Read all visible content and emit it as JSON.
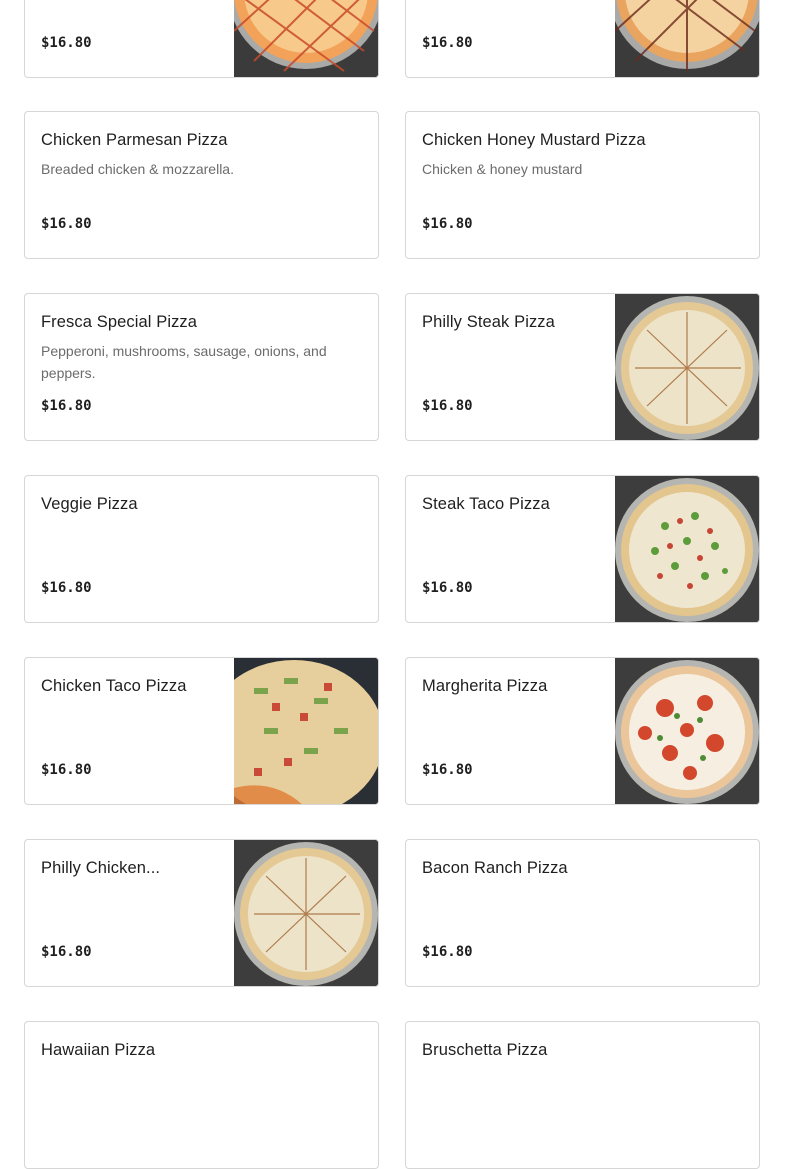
{
  "menu": {
    "items": [
      {
        "name": "",
        "description": "",
        "price": "$16.80",
        "image": "pizza-buffalo"
      },
      {
        "name": "",
        "description": "",
        "price": "$16.80",
        "image": "pizza-bbq"
      },
      {
        "name": "Chicken Parmesan Pizza",
        "description": "Breaded chicken & mozzarella.",
        "price": "$16.80",
        "image": null
      },
      {
        "name": "Chicken Honey Mustard Pizza",
        "description": "Chicken & honey mustard",
        "price": "$16.80",
        "image": null
      },
      {
        "name": "Fresca Special Pizza",
        "description": "Pepperoni, mushrooms, sausage, onions, and peppers.",
        "price": "$16.80",
        "image": null
      },
      {
        "name": "Philly Steak Pizza",
        "description": "",
        "price": "$16.80",
        "image": "pizza-white"
      },
      {
        "name": "Veggie Pizza",
        "description": "",
        "price": "$16.80",
        "image": null
      },
      {
        "name": "Steak Taco Pizza",
        "description": "",
        "price": "$16.80",
        "image": "pizza-taco"
      },
      {
        "name": "Chicken Taco Pizza",
        "description": "",
        "price": "$16.80",
        "image": "pizza-chicken-taco"
      },
      {
        "name": "Margherita Pizza",
        "description": "",
        "price": "$16.80",
        "image": "pizza-margherita"
      },
      {
        "name": "Philly Chicken...",
        "description": "",
        "price": "$16.80",
        "image": "pizza-white"
      },
      {
        "name": "Bacon Ranch Pizza",
        "description": "",
        "price": "$16.80",
        "image": null
      },
      {
        "name": "Hawaiian Pizza",
        "description": "",
        "price": "",
        "image": null
      },
      {
        "name": "Bruschetta Pizza",
        "description": "",
        "price": "",
        "image": null
      }
    ]
  },
  "colors": {
    "card_border": "#d6d6d6",
    "text": "#1f1f1f",
    "muted": "#6b6b6b",
    "photo_bg": "#3a3a3a"
  }
}
